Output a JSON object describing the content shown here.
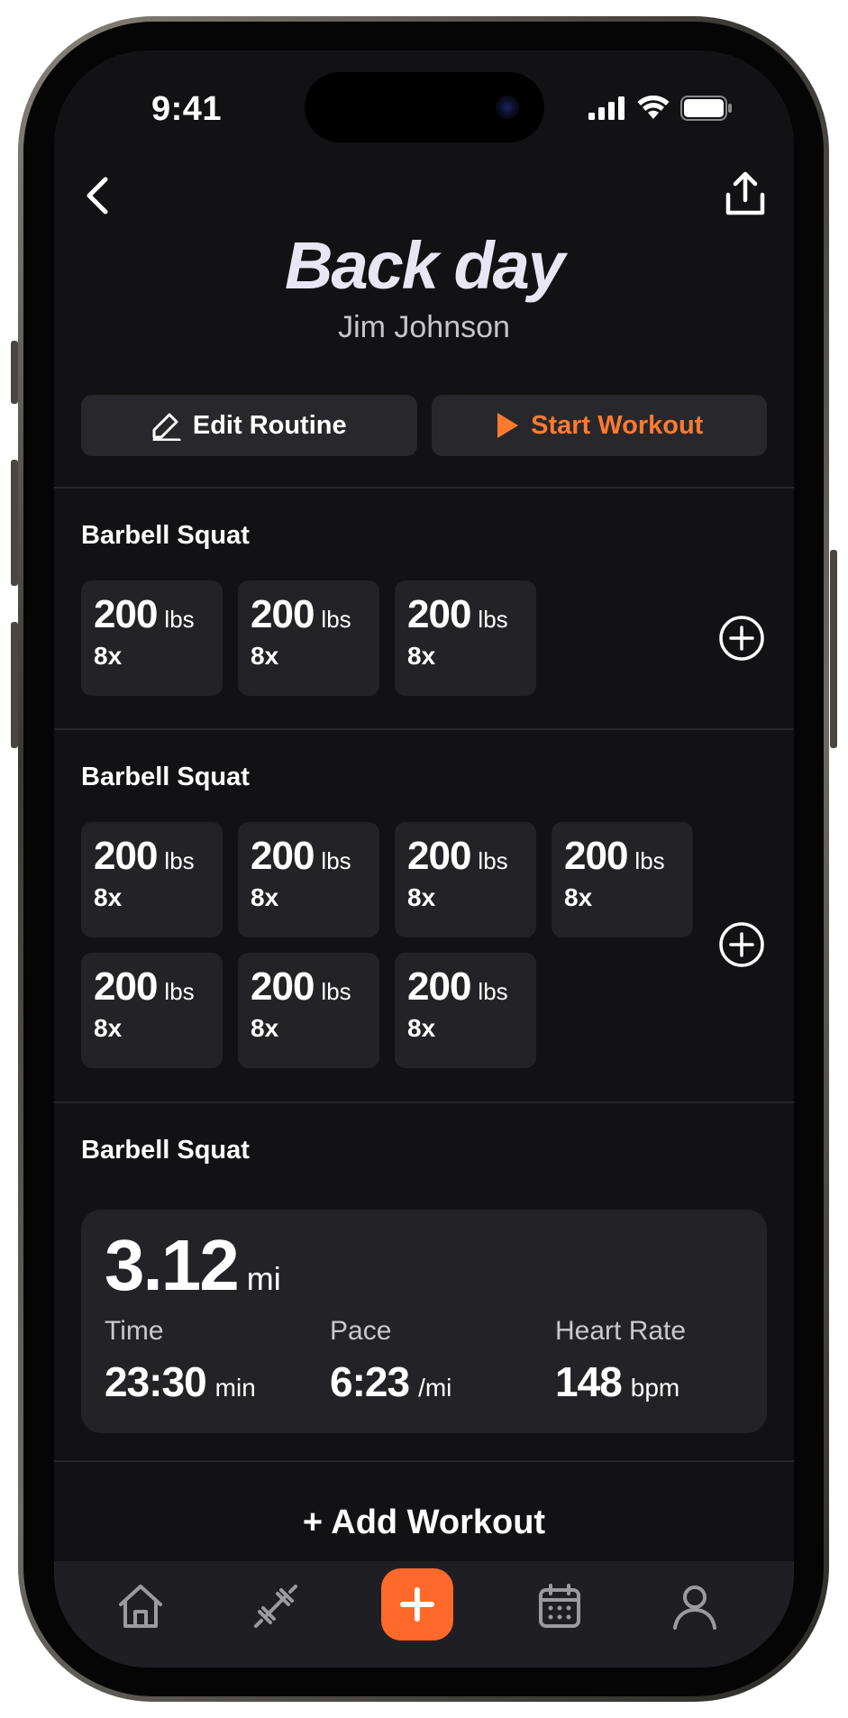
{
  "status_bar": {
    "time": "9:41"
  },
  "nav": {
    "back_icon": "chevron-left-icon",
    "share_icon": "share-icon"
  },
  "routine": {
    "title": "Back day",
    "author": "Jim Johnson"
  },
  "actions": {
    "edit_label": "Edit Routine",
    "start_label": "Start Workout",
    "accent_color": "#ff7a2f"
  },
  "exercises": [
    {
      "name": "Barbell Squat",
      "sets": [
        {
          "weight": "200",
          "unit": "lbs",
          "reps": "8x"
        },
        {
          "weight": "200",
          "unit": "lbs",
          "reps": "8x"
        },
        {
          "weight": "200",
          "unit": "lbs",
          "reps": "8x"
        }
      ]
    },
    {
      "name": "Barbell Squat",
      "sets": [
        {
          "weight": "200",
          "unit": "lbs",
          "reps": "8x"
        },
        {
          "weight": "200",
          "unit": "lbs",
          "reps": "8x"
        },
        {
          "weight": "200",
          "unit": "lbs",
          "reps": "8x"
        },
        {
          "weight": "200",
          "unit": "lbs",
          "reps": "8x"
        },
        {
          "weight": "200",
          "unit": "lbs",
          "reps": "8x"
        },
        {
          "weight": "200",
          "unit": "lbs",
          "reps": "8x"
        },
        {
          "weight": "200",
          "unit": "lbs",
          "reps": "8x"
        }
      ]
    }
  ],
  "cardio": {
    "name": "Barbell Squat",
    "distance": "3.12",
    "distance_unit": "mi",
    "metrics": [
      {
        "label": "Time",
        "value": "23:30",
        "unit": "min"
      },
      {
        "label": "Pace",
        "value": "6:23",
        "unit": "/mi"
      },
      {
        "label": "Heart Rate",
        "value": "148",
        "unit": "bpm"
      }
    ]
  },
  "add_workout_label": "+ Add Workout",
  "tab_bar": {
    "tabs": [
      "home-icon",
      "dumbbell-icon",
      "plus-icon",
      "calendar-icon",
      "profile-icon"
    ],
    "fab_color": "#ff6a2a"
  }
}
